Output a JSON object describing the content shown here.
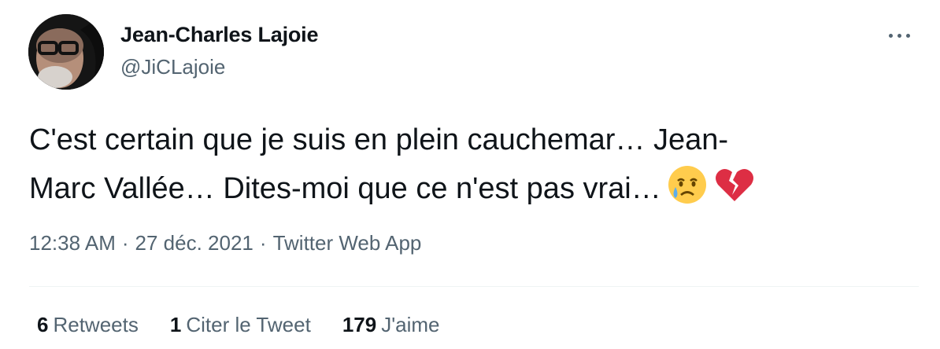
{
  "user": {
    "display_name": "Jean-Charles Lajoie",
    "handle": "@JiCLajoie"
  },
  "tweet": {
    "text_line1": "C'est certain que je suis en plein cauchemar… Jean-",
    "text_line2": "Marc Vallée… Dites-moi que ce n'est pas vrai…",
    "emojis": [
      "crying-face-icon",
      "broken-heart-icon"
    ]
  },
  "meta": {
    "time": "12:38 AM",
    "separator": "·",
    "date": "27 déc. 2021",
    "source": "Twitter Web App"
  },
  "stats": {
    "retweets_count": "6",
    "retweets_label": "Retweets",
    "quotes_count": "1",
    "quotes_label": "Citer le Tweet",
    "likes_count": "179",
    "likes_label": "J'aime"
  },
  "colors": {
    "text_primary": "#0f1419",
    "text_secondary": "#536471",
    "divider": "#eff3f4"
  }
}
